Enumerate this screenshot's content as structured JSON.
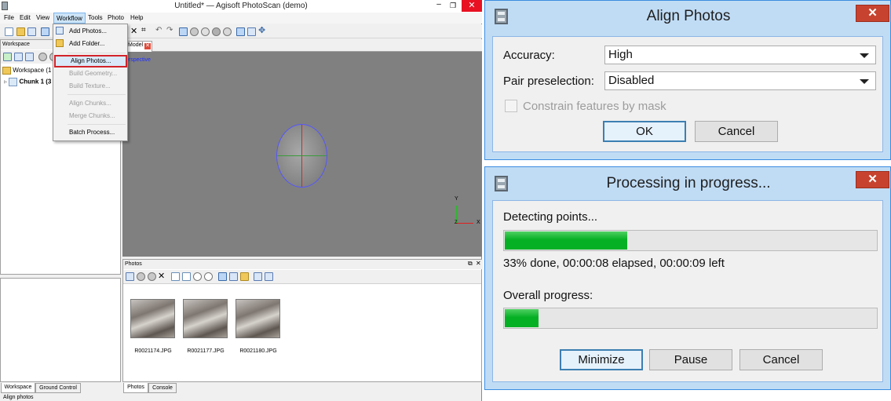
{
  "main_window": {
    "title": "Untitled* — Agisoft PhotoScan (demo)",
    "menubar": [
      "File",
      "Edit",
      "View",
      "Workflow",
      "Tools",
      "Photo",
      "Help"
    ],
    "workflow_menu": {
      "items": [
        {
          "label": "Add Photos...",
          "enabled": true
        },
        {
          "label": "Add Folder...",
          "enabled": true
        },
        {
          "label": "Align Photos...",
          "enabled": true,
          "highlighted": true
        },
        {
          "label": "Build Geometry...",
          "enabled": false
        },
        {
          "label": "Build Texture...",
          "enabled": false
        },
        {
          "label": "Align Chunks...",
          "enabled": false
        },
        {
          "label": "Merge Chunks...",
          "enabled": false
        },
        {
          "label": "Batch Process...",
          "enabled": true
        }
      ]
    },
    "workspace_panel": {
      "title": "Workspace",
      "root": "Workspace (1 ch",
      "chunk": "Chunk 1 (3 c"
    },
    "model_view": {
      "tab": "Model",
      "projection": "erspective",
      "axis_labels": {
        "y": "Y",
        "x": "X",
        "z": "Z"
      }
    },
    "photos_panel": {
      "title": "Photos",
      "photos": [
        {
          "filename": "R0021174.JPG"
        },
        {
          "filename": "R0021177.JPG"
        },
        {
          "filename": "R0021180.JPG"
        }
      ]
    },
    "bottom_tabs_left": [
      "Workspace",
      "Ground Control"
    ],
    "bottom_tabs_right": [
      "Photos",
      "Console"
    ],
    "status_bar": "Align photos"
  },
  "align_dialog": {
    "title": "Align Photos",
    "accuracy_label": "Accuracy:",
    "accuracy_value": "High",
    "pair_label": "Pair preselection:",
    "pair_value": "Disabled",
    "constrain_label": "Constrain features by mask",
    "constrain_checked": false,
    "ok_label": "OK",
    "cancel_label": "Cancel"
  },
  "progress_dialog": {
    "title": "Processing in progress...",
    "stage_label": "Detecting points...",
    "stage_progress": 0.33,
    "status_text": "33% done, 00:00:08 elapsed, 00:00:09 left",
    "overall_label": "Overall progress:",
    "overall_progress": 0.09,
    "minimize_label": "Minimize",
    "pause_label": "Pause",
    "cancel_label": "Cancel"
  },
  "colors": {
    "progress_fill": "#06b025",
    "menu_highlight_border": "#d2232a",
    "close_button": "#c7432f",
    "dialog_border": "#3b8de0",
    "viewport_bg": "#808080"
  }
}
